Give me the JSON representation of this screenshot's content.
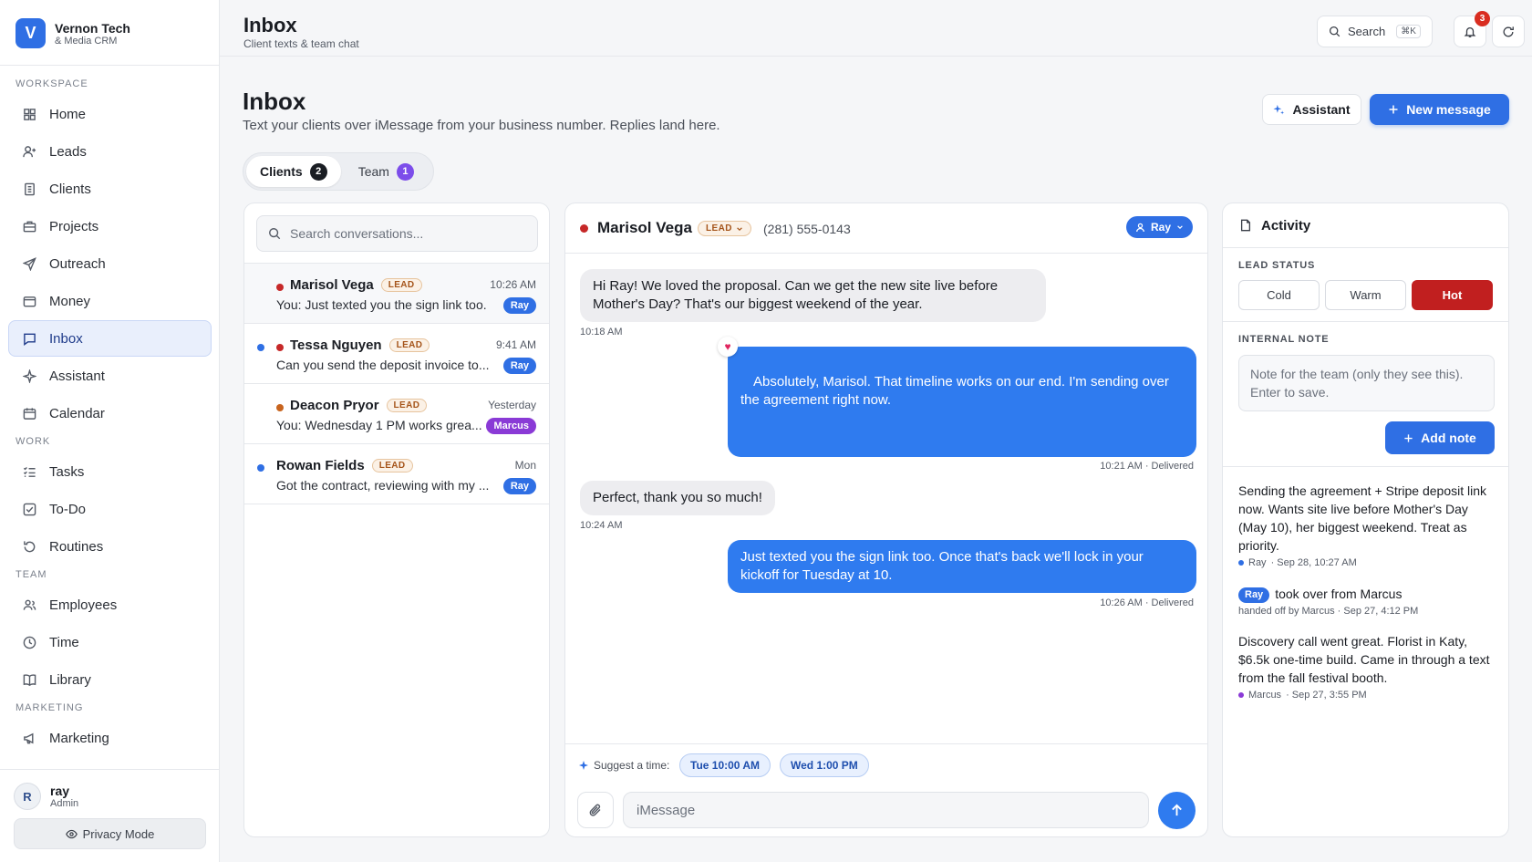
{
  "brand": {
    "logo_letter": "V",
    "name": "Vernon Tech",
    "subtitle": "& Media CRM"
  },
  "sidebar": {
    "sections": [
      {
        "label": "WORKSPACE",
        "items": [
          {
            "label": "Home",
            "icon": "grid-icon"
          },
          {
            "label": "Leads",
            "icon": "user-plus-icon"
          },
          {
            "label": "Clients",
            "icon": "building-icon"
          },
          {
            "label": "Projects",
            "icon": "briefcase-icon"
          },
          {
            "label": "Outreach",
            "icon": "send-icon"
          },
          {
            "label": "Money",
            "icon": "wallet-icon"
          },
          {
            "label": "Inbox",
            "icon": "chat-icon",
            "active": true
          },
          {
            "label": "Assistant",
            "icon": "sparkle-icon"
          },
          {
            "label": "Calendar",
            "icon": "calendar-icon"
          }
        ]
      },
      {
        "label": "WORK",
        "items": [
          {
            "label": "Tasks",
            "icon": "list-check-icon"
          },
          {
            "label": "To-Do",
            "icon": "checkbox-icon"
          },
          {
            "label": "Routines",
            "icon": "refresh-icon"
          }
        ]
      },
      {
        "label": "TEAM",
        "items": [
          {
            "label": "Employees",
            "icon": "users-icon"
          },
          {
            "label": "Time",
            "icon": "clock-icon"
          },
          {
            "label": "Library",
            "icon": "book-icon"
          }
        ]
      },
      {
        "label": "MARKETING",
        "items": [
          {
            "label": "Marketing",
            "icon": "megaphone-icon"
          }
        ]
      }
    ]
  },
  "user": {
    "initial": "R",
    "name": "ray",
    "role": "Admin",
    "privacy_label": "Privacy Mode"
  },
  "topbar": {
    "title": "Inbox",
    "subtitle": "Client texts & team chat",
    "search_label": "Search",
    "search_kbd": "⌘K",
    "notif_count": "3"
  },
  "page": {
    "title": "Inbox",
    "subtitle": "Text your clients over iMessage from your business number. Replies land here.",
    "assistant_label": "Assistant",
    "new_message_label": "New message"
  },
  "tabs": [
    {
      "label": "Clients",
      "count": "2",
      "active": true
    },
    {
      "label": "Team",
      "count": "1"
    }
  ],
  "conversations": {
    "search_placeholder": "Search conversations...",
    "items": [
      {
        "name": "Marisol Vega",
        "tag": "LEAD",
        "time": "10:26 AM",
        "preview": "You: Just texted you the sign link too.",
        "owner": "Ray",
        "unread": false,
        "status_color": "#c62828"
      },
      {
        "name": "Tessa Nguyen",
        "tag": "LEAD",
        "time": "9:41 AM",
        "preview": "Can you send the deposit invoice to...",
        "owner": "Ray",
        "unread": true,
        "status_color": "#c62828"
      },
      {
        "name": "Deacon Pryor",
        "tag": "LEAD",
        "time": "Yesterday",
        "preview": "You: Wednesday 1 PM works grea...",
        "owner": "Marcus",
        "unread": false,
        "status_color": "#c8641e"
      },
      {
        "name": "Rowan Fields",
        "tag": "LEAD",
        "time": "Mon",
        "preview": "Got the contract, reviewing with my ...",
        "owner": "Ray",
        "unread": true,
        "status_color": ""
      }
    ]
  },
  "chat": {
    "name": "Marisol Vega",
    "tag": "LEAD",
    "phone": "(281) 555-0143",
    "assignee": "Ray",
    "messages": [
      {
        "text": "Hi Ray! We loved the proposal. Can we get the new site live before Mother's Day? That's our biggest weekend of the year.",
        "meta": "10:18 AM",
        "dir": "in"
      },
      {
        "text": "Absolutely, Marisol. That timeline works on our end. I'm sending over the agreement right now.",
        "meta": "10:21 AM · Delivered",
        "dir": "out",
        "reaction": "♥"
      },
      {
        "text": "Perfect, thank you so much!",
        "meta": "10:24 AM",
        "dir": "in"
      },
      {
        "text": "Just texted you the sign link too. Once that's back we'll lock in your kickoff for Tuesday at 10.",
        "meta": "10:26 AM · Delivered",
        "dir": "out"
      }
    ],
    "suggest_label": "Suggest a time:",
    "suggestions": [
      "Tue 10:00 AM",
      "Wed 1:00 PM"
    ],
    "input_placeholder": "iMessage"
  },
  "activity": {
    "title": "Activity",
    "lead_status_label": "LEAD STATUS",
    "statuses": [
      "Cold",
      "Warm",
      "Hot"
    ],
    "selected_status": "Hot",
    "note_label": "INTERNAL NOTE",
    "note_placeholder": "Note for the team (only they see this). Enter to save.",
    "add_note_label": "Add note",
    "entries": [
      {
        "text": "Sending the agreement + Stripe deposit link now. Wants site live before Mother's Day (May 10), her biggest weekend. Treat as priority.",
        "author": "Ray",
        "time": "· Sep 28, 10:27 AM",
        "color": "#2f6fe4"
      },
      {
        "chip": "Ray",
        "text": "took over from Marcus",
        "meta": "handed off by Marcus · Sep 27, 4:12 PM"
      },
      {
        "text": "Discovery call went great. Florist in Katy, $6.5k one-time build. Came in through a text from the fall festival booth.",
        "author": "Marcus",
        "time": "· Sep 27, 3:55 PM",
        "color": "#8a3ad6"
      }
    ]
  }
}
